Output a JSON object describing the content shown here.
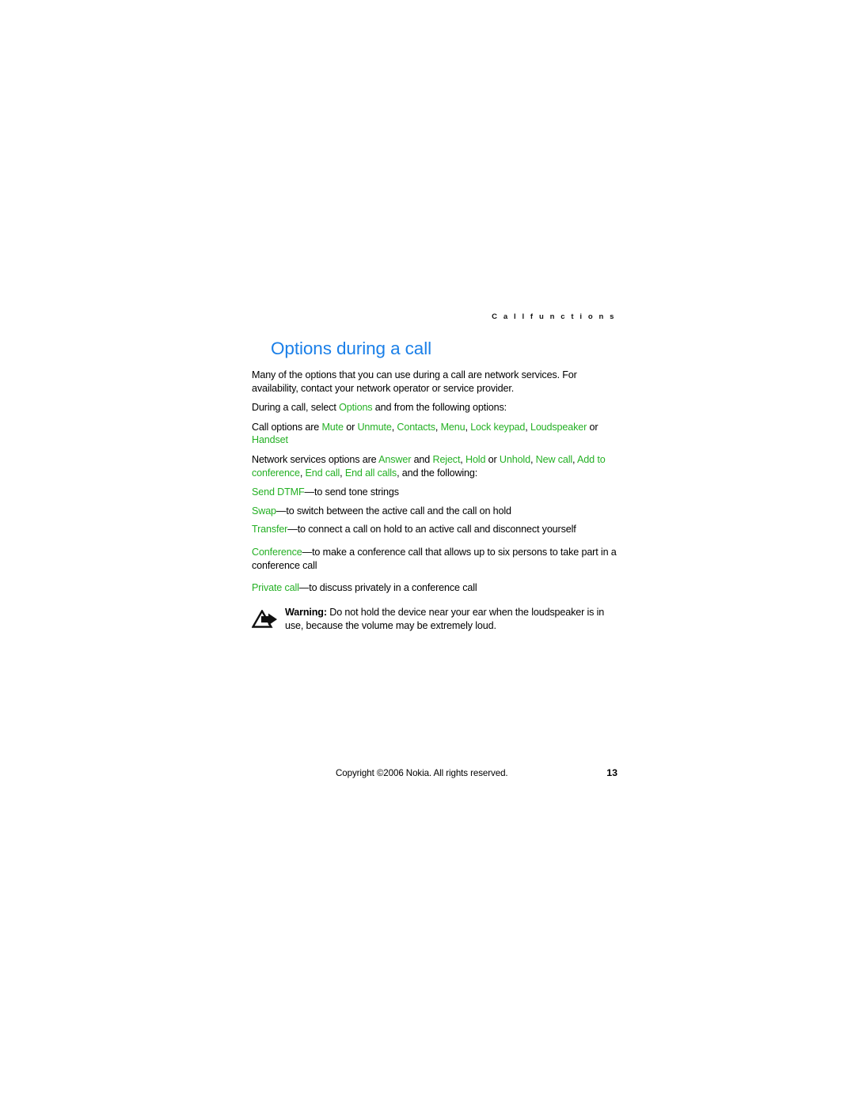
{
  "colors": {
    "title_blue": "#1a7fe8",
    "term_green": "#24b024",
    "text_black": "#000000",
    "page_background": "#ffffff"
  },
  "header": {
    "running_head": "C a l l   f u n c t i o n s"
  },
  "section": {
    "title": "Options during a call"
  },
  "paragraphs": {
    "intro": "Many of the options that you can use during a call are network services. For availability, contact your network operator or service provider.",
    "during_call_prefix": "During a call, select ",
    "during_call_term": "Options",
    "during_call_suffix": " and from the following options:",
    "call_options_prefix": "Call options are ",
    "network_services_prefix": "Network services options are "
  },
  "call_options": {
    "terms": [
      "Mute",
      "Unmute",
      "Contacts",
      "Menu",
      "Lock keypad",
      "Loudspeaker",
      "Handset"
    ],
    "or_1": " or ",
    "comma_1": ", ",
    "comma_2": ", ",
    "comma_3": ", ",
    "comma_4": ", ",
    "or_2": " or "
  },
  "network_services": {
    "terms": [
      "Answer",
      "Reject",
      "Hold",
      "Unhold",
      "New call",
      "Add to conference",
      "End call",
      "End all calls"
    ],
    "and_1": " and ",
    "comma_1": ", ",
    "or_1": " or ",
    "comma_2": ", ",
    "comma_3": ", ",
    "comma_4": ", ",
    "comma_5": ", ",
    "comma_6": ", ",
    "suffix": "and the following:"
  },
  "options_list": [
    {
      "term": "Send DTMF",
      "dash": "—",
      "description": "to send tone strings"
    },
    {
      "term": "Swap",
      "dash": "—",
      "description": "to switch between the active call and the call on hold"
    },
    {
      "term": "Transfer",
      "dash": "—",
      "description": "to connect a call on hold to an active call and disconnect yourself"
    },
    {
      "term": "Conference",
      "dash": "—",
      "description": "to make a conference call that allows up to six persons to take part in a conference call"
    },
    {
      "term": "Private call",
      "dash": "—",
      "description": "to discuss privately in a conference call"
    }
  ],
  "warning": {
    "label": "Warning:",
    "text": " Do not hold the device near your ear when the loudspeaker is in use, because the volume may be extremely loud.",
    "icon": "warning-triangle-arrow-icon"
  },
  "footer": {
    "copyright": "Copyright ©2006 Nokia. All rights reserved.",
    "page_number": "13"
  }
}
